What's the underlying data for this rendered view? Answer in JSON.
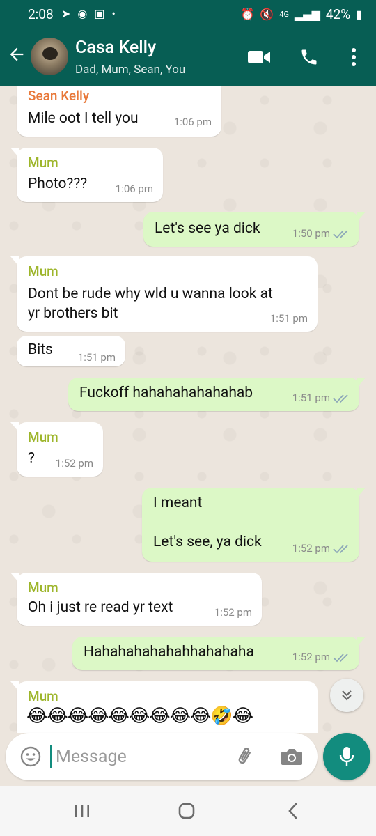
{
  "status_bar": {
    "time": "2:08",
    "network": "4G",
    "battery": "42%"
  },
  "header": {
    "title": "Casa Kelly",
    "subtitle": "Dad, Mum, Sean, You"
  },
  "messages": [
    {
      "direction": "in",
      "sender": "Sean Kelly",
      "text": "Mile oot I tell you",
      "time": "1:06 pm"
    },
    {
      "direction": "in",
      "sender": "Mum",
      "text": "Photo???",
      "time": "1:06 pm"
    },
    {
      "direction": "out",
      "text": "Let's see ya dick",
      "time": "1:50 pm"
    },
    {
      "direction": "in",
      "sender": "Mum",
      "text": "Dont be rude why wld u wanna look at\nyr brothers bit",
      "time": "1:51 pm"
    },
    {
      "direction": "in",
      "text": "Bits",
      "time": "1:51 pm"
    },
    {
      "direction": "out",
      "text": "Fuckoff hahahahahahahab",
      "time": "1:51 pm"
    },
    {
      "direction": "in",
      "sender": "Mum",
      "text": "?",
      "time": "1:52 pm"
    },
    {
      "direction": "out",
      "text": "I meant\n\nLet's see, ya dick",
      "time": "1:52 pm"
    },
    {
      "direction": "in",
      "sender": "Mum",
      "text": "Oh i just re read yr text",
      "time": "1:52 pm"
    },
    {
      "direction": "out",
      "text": "Hahahahahahahhahahaha",
      "time": "1:52 pm"
    },
    {
      "direction": "in",
      "sender": "Mum",
      "text": "😂😂😂😂😂😂😂😂😂🤣😂",
      "time": ""
    }
  ],
  "composer": {
    "placeholder": "Message"
  },
  "colors": {
    "header": "#075E54",
    "accent": "#128C7E",
    "outgoing_bubble": "#DCF8C6",
    "incoming_bubble": "#FFFFFF",
    "chat_background": "#ECE5DD",
    "sender_mum": "#9DB52A",
    "sender_sean": "#E8793A",
    "read_ticks": "#8ca7b8"
  },
  "icons": {
    "back": "arrow-left-icon",
    "video": "video-camera-icon",
    "call": "phone-icon",
    "menu": "more-vertical-icon",
    "scroll": "chevron-double-down-icon",
    "emoji": "emoji-icon",
    "attach": "paperclip-icon",
    "camera": "camera-icon",
    "mic": "microphone-icon"
  }
}
